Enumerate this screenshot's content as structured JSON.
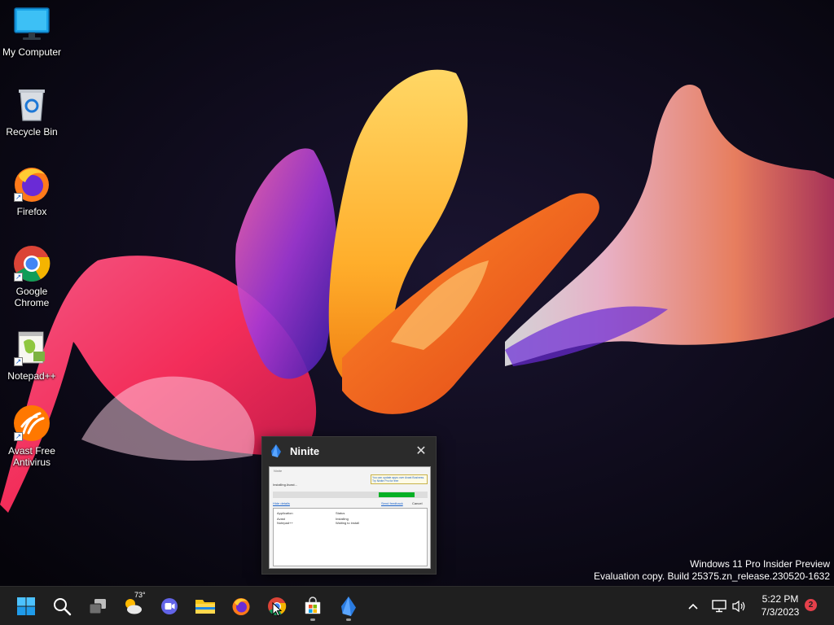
{
  "desktop": {
    "icons": [
      {
        "label_lines": [
          "My Computer"
        ],
        "icon": "monitor-icon"
      },
      {
        "label_lines": [
          "Recycle Bin"
        ],
        "icon": "recycle-bin-icon"
      },
      {
        "label_lines": [
          "Firefox"
        ],
        "icon": "firefox-icon"
      },
      {
        "label_lines": [
          "Google",
          "Chrome"
        ],
        "icon": "chrome-icon"
      },
      {
        "label_lines": [
          "Notepad++"
        ],
        "icon": "notepad-plus-plus-icon"
      },
      {
        "label_lines": [
          "Avast Free",
          "Antivirus"
        ],
        "icon": "avast-icon"
      }
    ],
    "watermark": {
      "line1": "Windows 11 Pro Insider Preview",
      "line2": "Evaluation copy. Build 25375.zn_release.230520-1632"
    }
  },
  "preview": {
    "title": "Ninite",
    "close_glyph": "✕",
    "thumbnail": {
      "window_title": "Ninite",
      "notice": "You can update apps over Avast Business. Try Ninite Pro for free",
      "status": "Installing Avast...",
      "link_left": "Hide details",
      "link_right": "Send feedback",
      "cancel": "Cancel",
      "col_application": "Application",
      "col_status": "Status",
      "rows": [
        {
          "app": "Avast",
          "status": "Installing"
        },
        {
          "app": "Notepad++",
          "status": "Waiting to install"
        }
      ],
      "progress": 0.23
    }
  },
  "taskbar": {
    "weather_temp": "73°",
    "clock_time": "5:22 PM",
    "clock_date": "7/3/2023",
    "notification_count": "2",
    "colors": {
      "accent": "#0078d4",
      "badge": "#e5404b",
      "taskbar": "#1f1f1f"
    }
  }
}
